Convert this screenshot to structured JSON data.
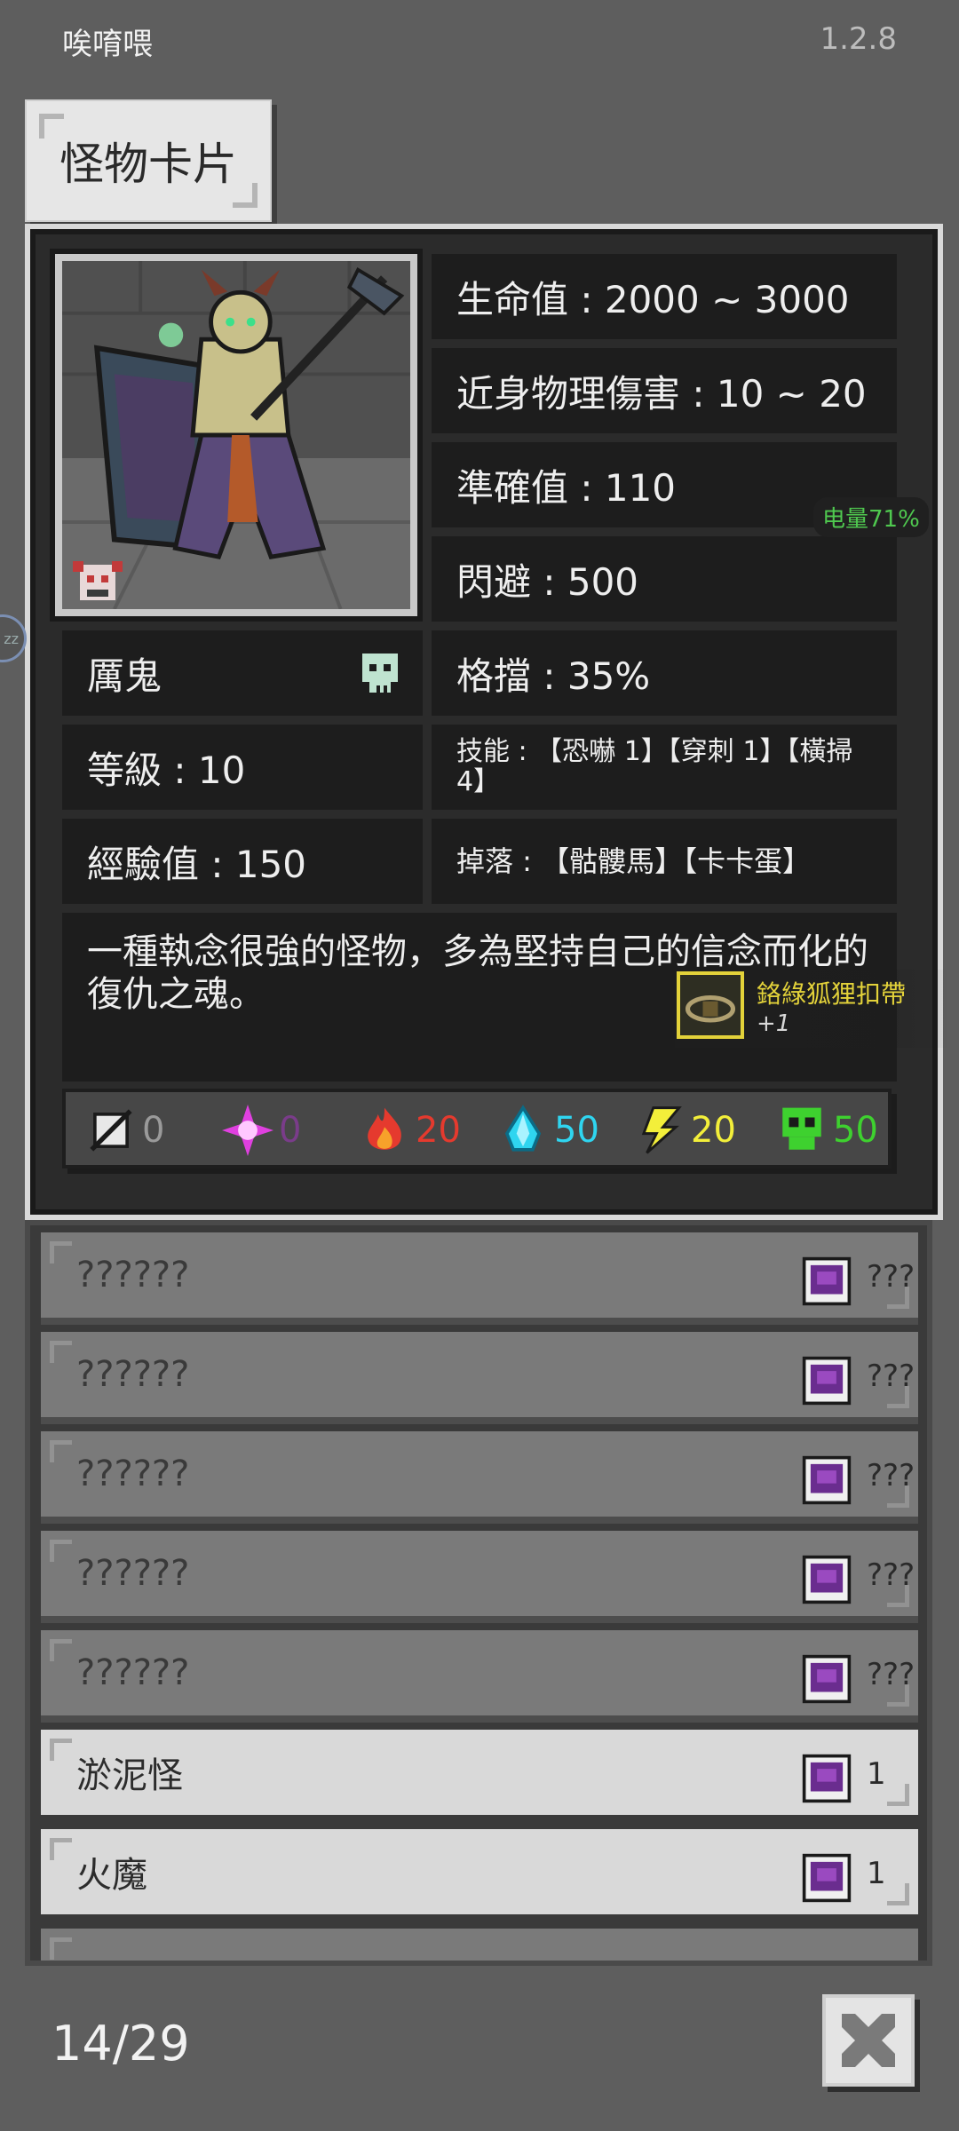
{
  "app": {
    "title": "唉唷喂",
    "version": "1.2.8"
  },
  "title_tab": {
    "label": "怪物卡片"
  },
  "monster": {
    "name": "厲鬼",
    "level": "等級 : 10",
    "exp": "經驗值 : 150",
    "hp": "生命值 : 2000 ~ 3000",
    "melee_damage": "近身物理傷害 : 10 ~ 20",
    "accuracy": "準確值 : 110",
    "dodge": "閃避 : 500",
    "block": "格擋 : 35%",
    "skills": "技能 : 【恐嚇 1】【穿刺 1】【橫掃 4】",
    "drops": "掉落 : 【骷髏馬】【卡卡蛋】",
    "description": "一種執念很強的怪物，多為堅持自己的信念而化的復仇之魂。",
    "type_icon": "skull-icon"
  },
  "status": {
    "battery": "电量71%"
  },
  "drop_notice": {
    "item_name": "鉻綠狐狸扣帶",
    "bonus": "+1"
  },
  "resistances": [
    {
      "name": "physical",
      "icon": "sword-icon",
      "value": "0",
      "color": "#9a9a9a"
    },
    {
      "name": "arcane",
      "icon": "magic-star-icon",
      "value": "0",
      "color": "#7a3c8a"
    },
    {
      "name": "fire",
      "icon": "fire-icon",
      "value": "20",
      "color": "#e53a2e"
    },
    {
      "name": "ice",
      "icon": "ice-crystal-icon",
      "value": "50",
      "color": "#2fd5f0"
    },
    {
      "name": "lightning",
      "icon": "lightning-icon",
      "value": "20",
      "color": "#f3ef3a"
    },
    {
      "name": "poison",
      "icon": "poison-skull-icon",
      "value": "50",
      "color": "#3ed12f"
    }
  ],
  "list": {
    "rows": [
      {
        "name": "??????",
        "count": "???",
        "locked": true
      },
      {
        "name": "??????",
        "count": "???",
        "locked": true
      },
      {
        "name": "??????",
        "count": "???",
        "locked": true
      },
      {
        "name": "??????",
        "count": "???",
        "locked": true
      },
      {
        "name": "??????",
        "count": "???",
        "locked": true
      },
      {
        "name": "淤泥怪",
        "count": "1",
        "locked": false
      },
      {
        "name": "火魔",
        "count": "1",
        "locked": false
      }
    ]
  },
  "footer": {
    "page": "14/29"
  },
  "side_indicator": {
    "label": "zz"
  },
  "colors": {
    "background": "#5e5e5e",
    "panel": "#1d1d1d",
    "accent_yellow": "#e3d23a",
    "battery_green": "#4fc84f"
  }
}
